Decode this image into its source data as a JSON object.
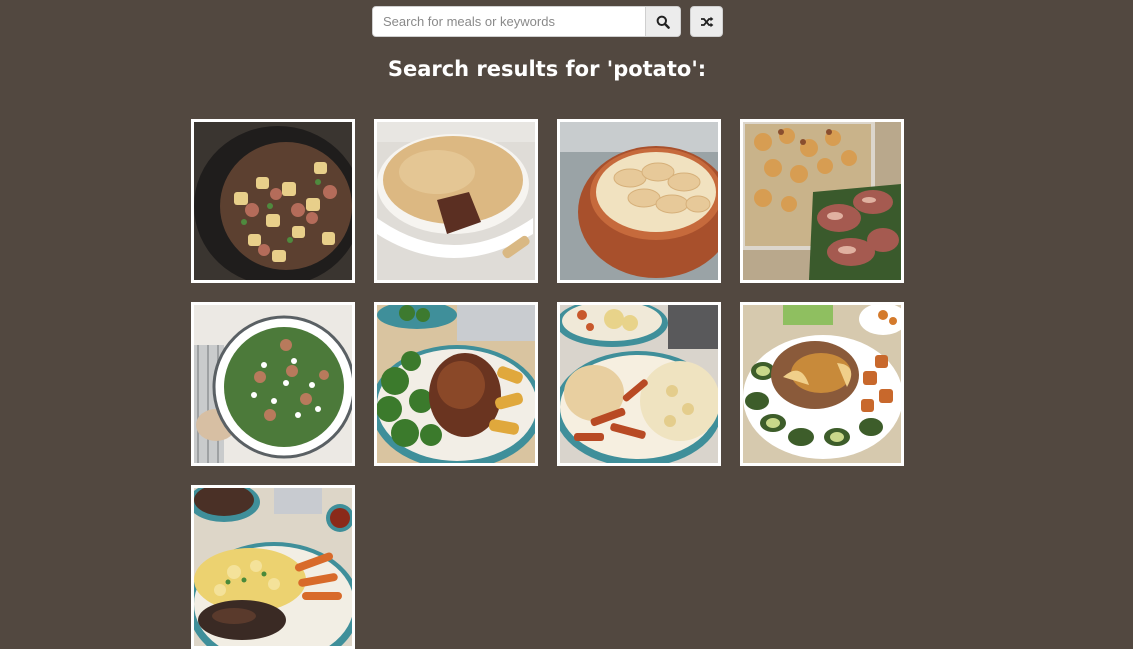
{
  "search": {
    "placeholder": "Search for meals or keywords",
    "value": ""
  },
  "icons": {
    "search": "search-icon",
    "random": "shuffle-icon"
  },
  "results": {
    "title": "Search results for 'potato':",
    "meals": [
      {
        "dish": "potato-skillet"
      },
      {
        "dish": "meat-pie"
      },
      {
        "dish": "potato-gratin"
      },
      {
        "dish": "roast-potato-tray"
      },
      {
        "dish": "potato-salad"
      },
      {
        "dish": "chicken-broccoli-wedges"
      },
      {
        "dish": "chicken-mac-cheese"
      },
      {
        "dish": "pork-chop-zucchini"
      },
      {
        "dish": "steak-potato-salad"
      }
    ]
  },
  "colors": {
    "background": "#524840",
    "card_border": "#ffffff",
    "title_text": "#ffffff"
  }
}
